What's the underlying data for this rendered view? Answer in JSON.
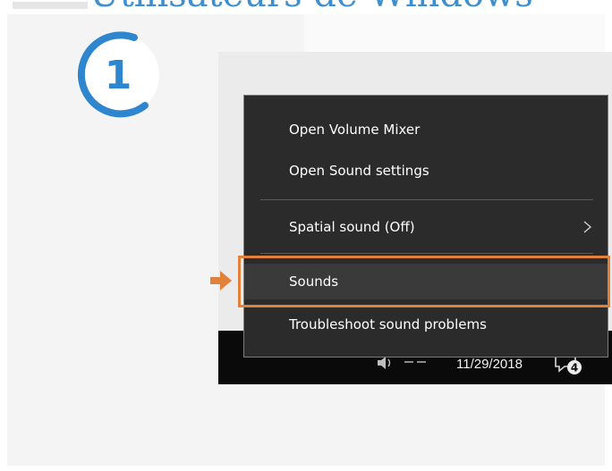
{
  "header": {
    "title": "Utilisateurs de Windows"
  },
  "step": {
    "number": "1"
  },
  "context_menu": {
    "items": [
      {
        "label": "Open Volume Mixer"
      },
      {
        "label": "Open Sound settings"
      },
      {
        "label": "Spatial sound (Off)",
        "has_submenu": true
      },
      {
        "label": "Sounds",
        "highlighted": true
      },
      {
        "label": "Troubleshoot sound problems"
      }
    ]
  },
  "taskbar": {
    "date": "11/29/2018",
    "notification_count": "4"
  },
  "colors": {
    "accent_blue": "#2e86cf",
    "highlight_orange": "#e2813a",
    "menu_background": "#2b2b2b",
    "taskbar_background": "#0a0a0a"
  },
  "icons": {
    "step_ring": "step-ring-icon",
    "pointer_arrow": "arrow-right-icon",
    "submenu": "chevron-right-icon",
    "volume": "speaker-icon",
    "notifications": "notification-icon"
  }
}
